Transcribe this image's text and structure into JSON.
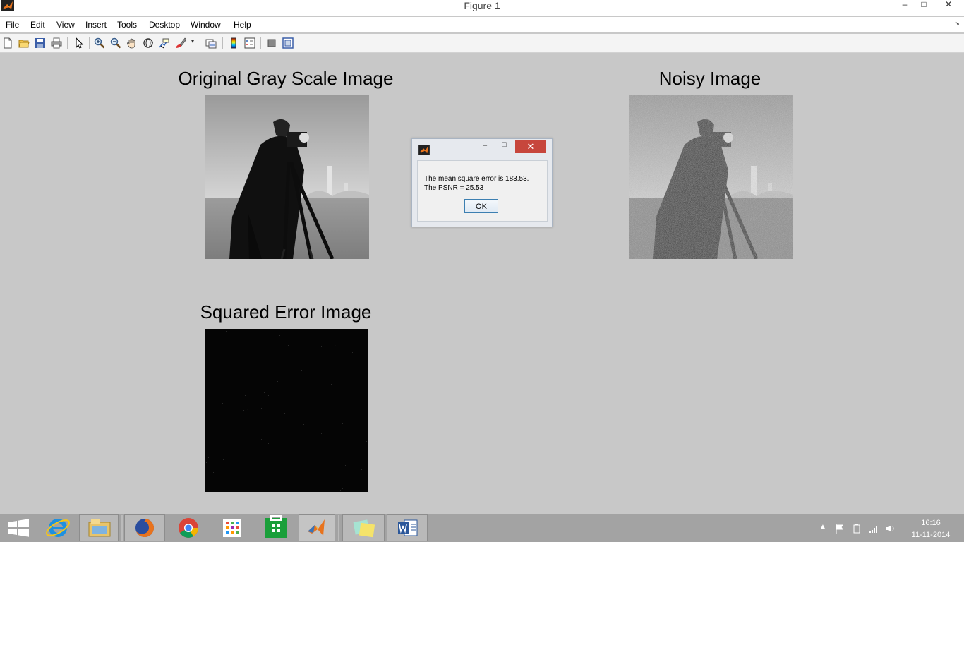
{
  "window": {
    "title": "Figure 1",
    "minimize": "–",
    "maximize": "□",
    "close": "✕"
  },
  "menu": [
    "File",
    "Edit",
    "View",
    "Insert",
    "Tools",
    "Desktop",
    "Window",
    "Help"
  ],
  "toolbar_icons": [
    "new-figure-icon",
    "open-file-icon",
    "save-icon",
    "print-icon",
    "pointer-icon",
    "zoom-in-icon",
    "zoom-out-icon",
    "pan-icon",
    "rotate-3d-icon",
    "data-cursor-icon",
    "brush-icon",
    "link-plot-icon",
    "colorbar-icon",
    "legend-icon",
    "hide-plot-tools-icon",
    "show-plot-tools-icon"
  ],
  "plots": {
    "original_title": "Original Gray Scale Image",
    "noisy_title": "Noisy Image",
    "error_title": "Squared Error Image"
  },
  "dialog": {
    "line1": "The mean square error is 183.53.",
    "line2": "The PSNR = 25.53",
    "ok": "OK",
    "close": "✕"
  },
  "taskbar": {
    "apps": [
      "start-icon",
      "internet-explorer-icon",
      "file-explorer-icon",
      "firefox-icon",
      "chrome-icon",
      "apps-grid-icon",
      "store-icon",
      "matlab-icon",
      "sticky-notes-icon",
      "word-icon"
    ],
    "time": "16:16",
    "date": "11-11-2014"
  },
  "colors": {
    "figure_bg": "#c8c8c8",
    "taskbar": "#a3a3a3",
    "close_red": "#c7463c"
  }
}
